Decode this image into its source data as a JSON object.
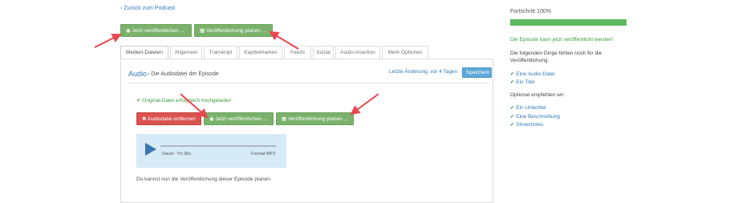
{
  "back_link": "Zurück zum Podcast",
  "top_actions": {
    "publish_now": "Jetzt veröffentlichen ...",
    "schedule": "Veröffentlichung planen ..."
  },
  "tabs": [
    "Medien-Dateien",
    "Allgemein",
    "Transkript",
    "Kapitelmarken",
    "Feeds",
    "Social",
    "Audio-Insertion",
    "Mehr Optionen"
  ],
  "section": {
    "title": "Audio",
    "subtitle": "Die Audiodatei der Episode",
    "last_change": "Letzte Änderung: vor 4 Tagen",
    "save": "Speichern"
  },
  "upload_status": "Original-Datei erfolgreich hochgeladen",
  "file_actions": {
    "remove": "Audiodatei entfernen",
    "publish_now": "Jetzt veröffentlichen ...",
    "schedule": "Veröffentlichung planen ..."
  },
  "player": {
    "duration": "Dauer: 7m 36s",
    "format": "Format MP3"
  },
  "note": "Du kannst nun die Veröffentlichung dieser Episode planen.",
  "sidebar": {
    "progress_label": "Fortschritt 100%",
    "progress_value": 1.0,
    "ready": "Die Episode kann jetzt veröffentlicht werden!",
    "missing_intro": "Die folgenden Dinge fehlen noch für die Veröffentlichung:",
    "missing": [
      "Eine Audio-Datei",
      "Ein Titel"
    ],
    "optional_intro": "Optional empfehlen wir:",
    "optional": [
      "Ein Untertitel",
      "Eine Beschreibung",
      "Showmotes"
    ]
  },
  "colors": {
    "green_button": "#7ab26b",
    "red_button": "#d9534f",
    "blue_button": "#5fa8d9",
    "progress": "#5cb85c",
    "arrow": "#e8474f",
    "link": "#337ab7"
  }
}
